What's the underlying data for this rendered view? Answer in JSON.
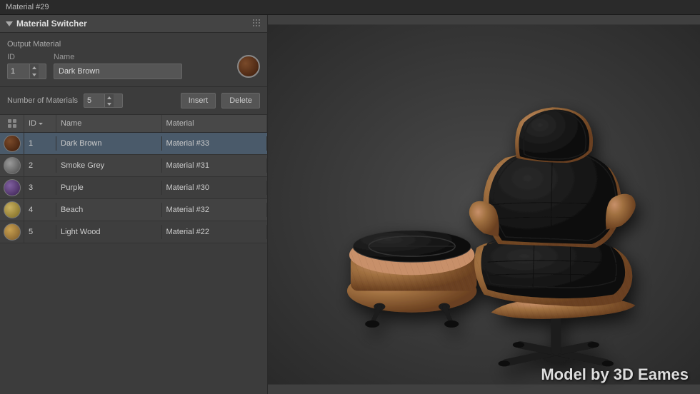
{
  "titleBar": {
    "label": "Material #29"
  },
  "panelHeader": {
    "title": "Material Switcher"
  },
  "outputMaterial": {
    "sectionLabel": "Output Material",
    "idLabel": "ID",
    "nameLabel": "Name",
    "idValue": "1",
    "nameValue": "Dark Brown"
  },
  "numMaterials": {
    "label": "Number of Materials",
    "value": "5",
    "insertBtn": "Insert",
    "deleteBtn": "Delete"
  },
  "tableHeaders": {
    "swatchCol": "",
    "idCol": "ID",
    "nameCol": "Name",
    "materialCol": "Material"
  },
  "tableRows": [
    {
      "id": 1,
      "name": "Dark Brown",
      "material": "Material #33",
      "swatch": "dark-brown",
      "selected": true
    },
    {
      "id": 2,
      "name": "Smoke Grey",
      "material": "Material #31",
      "swatch": "smoke-grey",
      "selected": false
    },
    {
      "id": 3,
      "name": "Purple",
      "material": "Material #30",
      "swatch": "purple",
      "selected": false
    },
    {
      "id": 4,
      "name": "Beach",
      "material": "Material #32",
      "swatch": "beach",
      "selected": false
    },
    {
      "id": 5,
      "name": "Light Wood",
      "material": "Material #22",
      "swatch": "light-wood",
      "selected": false
    }
  ],
  "watermark": "Model by 3D Eames"
}
